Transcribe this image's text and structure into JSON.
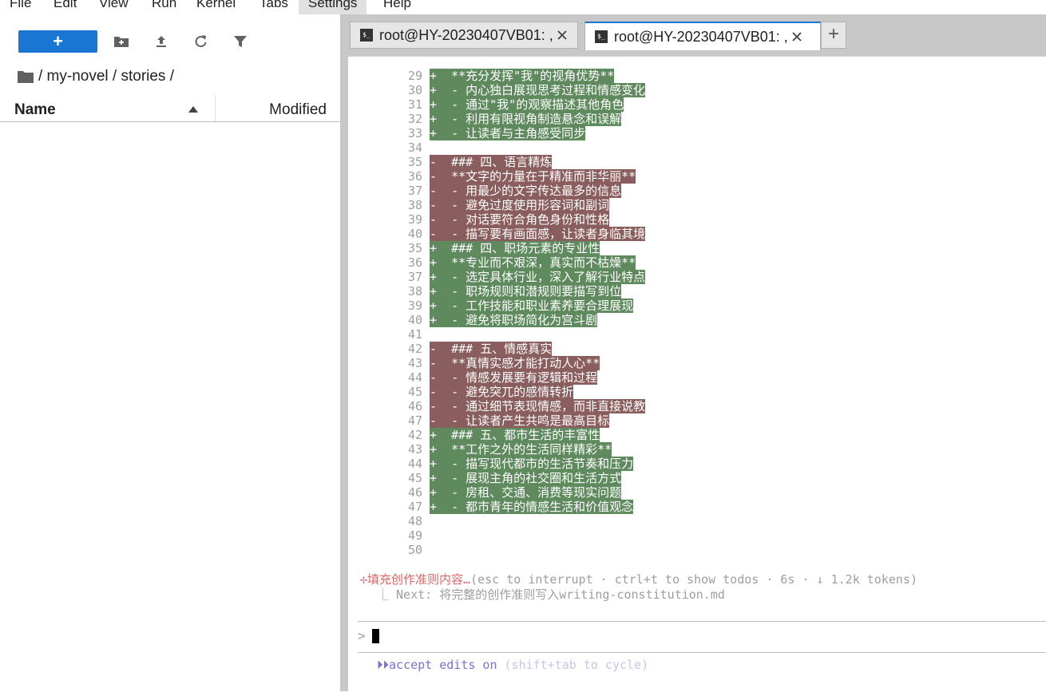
{
  "menubar": {
    "items": [
      "File",
      "Edit",
      "View",
      "Run",
      "Kernel",
      "Tabs",
      "Settings",
      "Help"
    ],
    "active": "Settings"
  },
  "filebrowser": {
    "new_label": "+",
    "breadcrumb": "/ my-novel / stories /",
    "columns": {
      "name": "Name",
      "modified": "Modified"
    },
    "icons": [
      "new-folder-icon",
      "upload-icon",
      "refresh-icon",
      "filter-icon"
    ]
  },
  "tabs": [
    {
      "label": "root@HY-20230407VB01: ,"
    },
    {
      "label": "root@HY-20230407VB01: ,"
    }
  ],
  "add_tab_label": "+",
  "diff": [
    {
      "num": "29",
      "type": "add",
      "text": "+  **充分发挥\"我\"的视角优势**"
    },
    {
      "num": "30",
      "type": "add",
      "text": "+  - 内心独白展现思考过程和情感变化"
    },
    {
      "num": "31",
      "type": "add",
      "text": "+  - 通过\"我\"的观察描述其他角色"
    },
    {
      "num": "32",
      "type": "add",
      "text": "+  - 利用有限视角制造悬念和误解"
    },
    {
      "num": "33",
      "type": "add",
      "text": "+  - 让读者与主角感受同步"
    },
    {
      "num": "34",
      "type": "ctx",
      "text": ""
    },
    {
      "num": "35",
      "type": "del",
      "text": "-  ### 四、语言精炼"
    },
    {
      "num": "36",
      "type": "del",
      "text": "-  **文字的力量在于精准而非华丽**"
    },
    {
      "num": "37",
      "type": "del",
      "text": "-  - 用最少的文字传达最多的信息"
    },
    {
      "num": "38",
      "type": "del",
      "text": "-  - 避免过度使用形容词和副词"
    },
    {
      "num": "39",
      "type": "del",
      "text": "-  - 对话要符合角色身份和性格"
    },
    {
      "num": "40",
      "type": "del",
      "text": "-  - 描写要有画面感，让读者身临其境"
    },
    {
      "num": "35",
      "type": "add",
      "text": "+  ### 四、职场元素的专业性"
    },
    {
      "num": "36",
      "type": "add",
      "text": "+  **专业而不艰深，真实而不枯燥**"
    },
    {
      "num": "37",
      "type": "add",
      "text": "+  - 选定具体行业，深入了解行业特点"
    },
    {
      "num": "38",
      "type": "add",
      "text": "+  - 职场规则和潜规则要描写到位"
    },
    {
      "num": "39",
      "type": "add",
      "text": "+  - 工作技能和职业素养要合理展现"
    },
    {
      "num": "40",
      "type": "add",
      "text": "+  - 避免将职场简化为宫斗剧"
    },
    {
      "num": "41",
      "type": "ctx",
      "text": ""
    },
    {
      "num": "42",
      "type": "del",
      "text": "-  ### 五、情感真实"
    },
    {
      "num": "43",
      "type": "del",
      "text": "-  **真情实感才能打动人心**"
    },
    {
      "num": "44",
      "type": "del",
      "text": "-  - 情感发展要有逻辑和过程"
    },
    {
      "num": "45",
      "type": "del",
      "text": "-  - 避免突兀的感情转折"
    },
    {
      "num": "46",
      "type": "del",
      "text": "-  - 通过细节表现情感，而非直接说教"
    },
    {
      "num": "47",
      "type": "del",
      "text": "-  - 让读者产生共鸣是最高目标"
    },
    {
      "num": "42",
      "type": "add",
      "text": "+  ### 五、都市生活的丰富性"
    },
    {
      "num": "43",
      "type": "add",
      "text": "+  **工作之外的生活同样精彩**"
    },
    {
      "num": "44",
      "type": "add",
      "text": "+  - 描写现代都市的生活节奏和压力"
    },
    {
      "num": "45",
      "type": "add",
      "text": "+  - 展现主角的社交圈和生活方式"
    },
    {
      "num": "46",
      "type": "add",
      "text": "+  - 房租、交通、消费等现实问题"
    },
    {
      "num": "47",
      "type": "add",
      "text": "+  - 都市青年的情感生活和价值观念"
    },
    {
      "num": "48",
      "type": "ctx",
      "text": ""
    },
    {
      "num": "49",
      "type": "ctx",
      "text": ""
    },
    {
      "num": "50",
      "type": "ctx",
      "text": ""
    }
  ],
  "status": {
    "spinner": "✢",
    "task": "填充创作准则内容…",
    "meta": "(esc to interrupt · ctrl+t to show todos · 6s · ↓ 1.2k tokens)"
  },
  "next": "⎿ Next: 将完整的创作准则写入writing-constitution.md",
  "prompt_caret": ">",
  "accept": {
    "arrows": "⏵⏵",
    "label": "accept edits on",
    "hint": "(shift+tab to cycle)"
  },
  "colors": {
    "accent": "#1976d2",
    "diff_add": "#5e8a5e",
    "diff_del": "#8a5e5e",
    "status_red": "#d96a6a",
    "accept_purple": "#7b6fd6"
  }
}
